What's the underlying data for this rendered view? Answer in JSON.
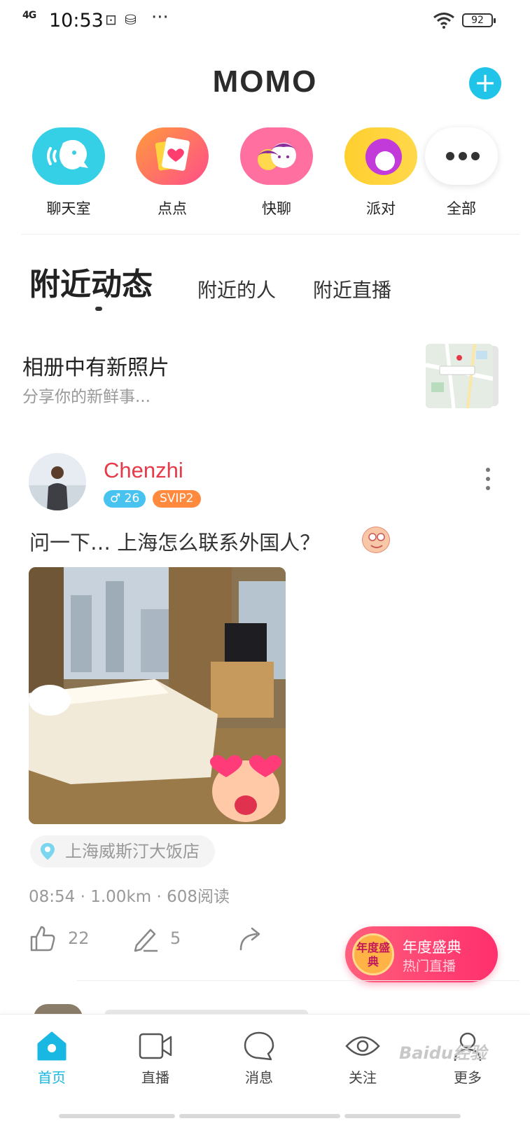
{
  "status_bar": {
    "network": "4G",
    "time": "10:53",
    "battery": "92"
  },
  "header": {
    "logo": "MOMO",
    "add_icon": "plus-icon"
  },
  "shortcuts": [
    {
      "label": "聊天室",
      "icon": "chatroom-icon",
      "color": "#35cfe6"
    },
    {
      "label": "点点",
      "icon": "heart-card-icon",
      "color": "#ff6b6b"
    },
    {
      "label": "快聊",
      "icon": "quick-chat-icon",
      "color": "#ff6f9f"
    },
    {
      "label": "派对",
      "icon": "party-icon",
      "color": "#ffcf2f"
    },
    {
      "label": "全部",
      "icon": "more-icon",
      "color": "#ffffff"
    }
  ],
  "tabs": {
    "active": "附近动态",
    "items": [
      "附近的人",
      "附近直播"
    ]
  },
  "album_prompt": {
    "title": "相册中有新照片",
    "subtitle": "分享你的新鲜事..."
  },
  "post": {
    "username": "Chenzhi",
    "gender_symbol": "♂",
    "age": "26",
    "vip": "SVIP2",
    "text": "问一下… 上海怎么联系外国人？",
    "location": "上海威斯汀大饭店",
    "meta": {
      "time": "08:54",
      "distance": "1.00km",
      "reads": "608阅读",
      "separator": "·"
    },
    "likes": "22",
    "comments": "5"
  },
  "promo": {
    "medal": "年度盛典",
    "title": "年度盛典",
    "subtitle": "热门直播"
  },
  "bottom_nav": [
    {
      "label": "首页",
      "icon": "home-icon",
      "active": true
    },
    {
      "label": "直播",
      "icon": "video-camera-icon",
      "active": false
    },
    {
      "label": "消息",
      "icon": "chat-bubble-icon",
      "active": false
    },
    {
      "label": "关注",
      "icon": "eye-icon",
      "active": false
    },
    {
      "label": "更多",
      "icon": "profile-icon",
      "active": false
    }
  ],
  "watermark": "Baidu经验",
  "colors": {
    "accent": "#1fc4e8",
    "username": "#e63a48",
    "vip": "#ff8a3d",
    "promo": "#ff3f72"
  }
}
